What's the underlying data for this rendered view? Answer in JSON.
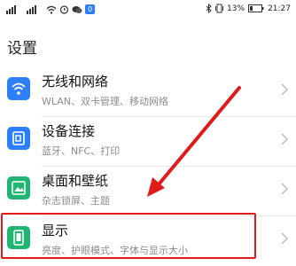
{
  "status_bar": {
    "left_badge": "0",
    "battery_percent": "13%",
    "time": "21:27"
  },
  "page_title": "设置",
  "items": [
    {
      "title": "无线和网络",
      "subtitle": "WLAN、双卡管理、移动网络",
      "icon": "wifi-icon",
      "color": "#2d7ff9"
    },
    {
      "title": "设备连接",
      "subtitle": "蓝牙、NFC、打印",
      "icon": "device-connect-icon",
      "color": "#2d7ff9"
    },
    {
      "title": "桌面和壁纸",
      "subtitle": "杂志锁屏、主题",
      "icon": "wallpaper-icon",
      "color": "#21b573"
    },
    {
      "title": "显示",
      "subtitle": "亮度、护眼模式、字体与显示大小",
      "icon": "display-icon",
      "color": "#21b573"
    }
  ],
  "annotation_color": "#e11a1a"
}
